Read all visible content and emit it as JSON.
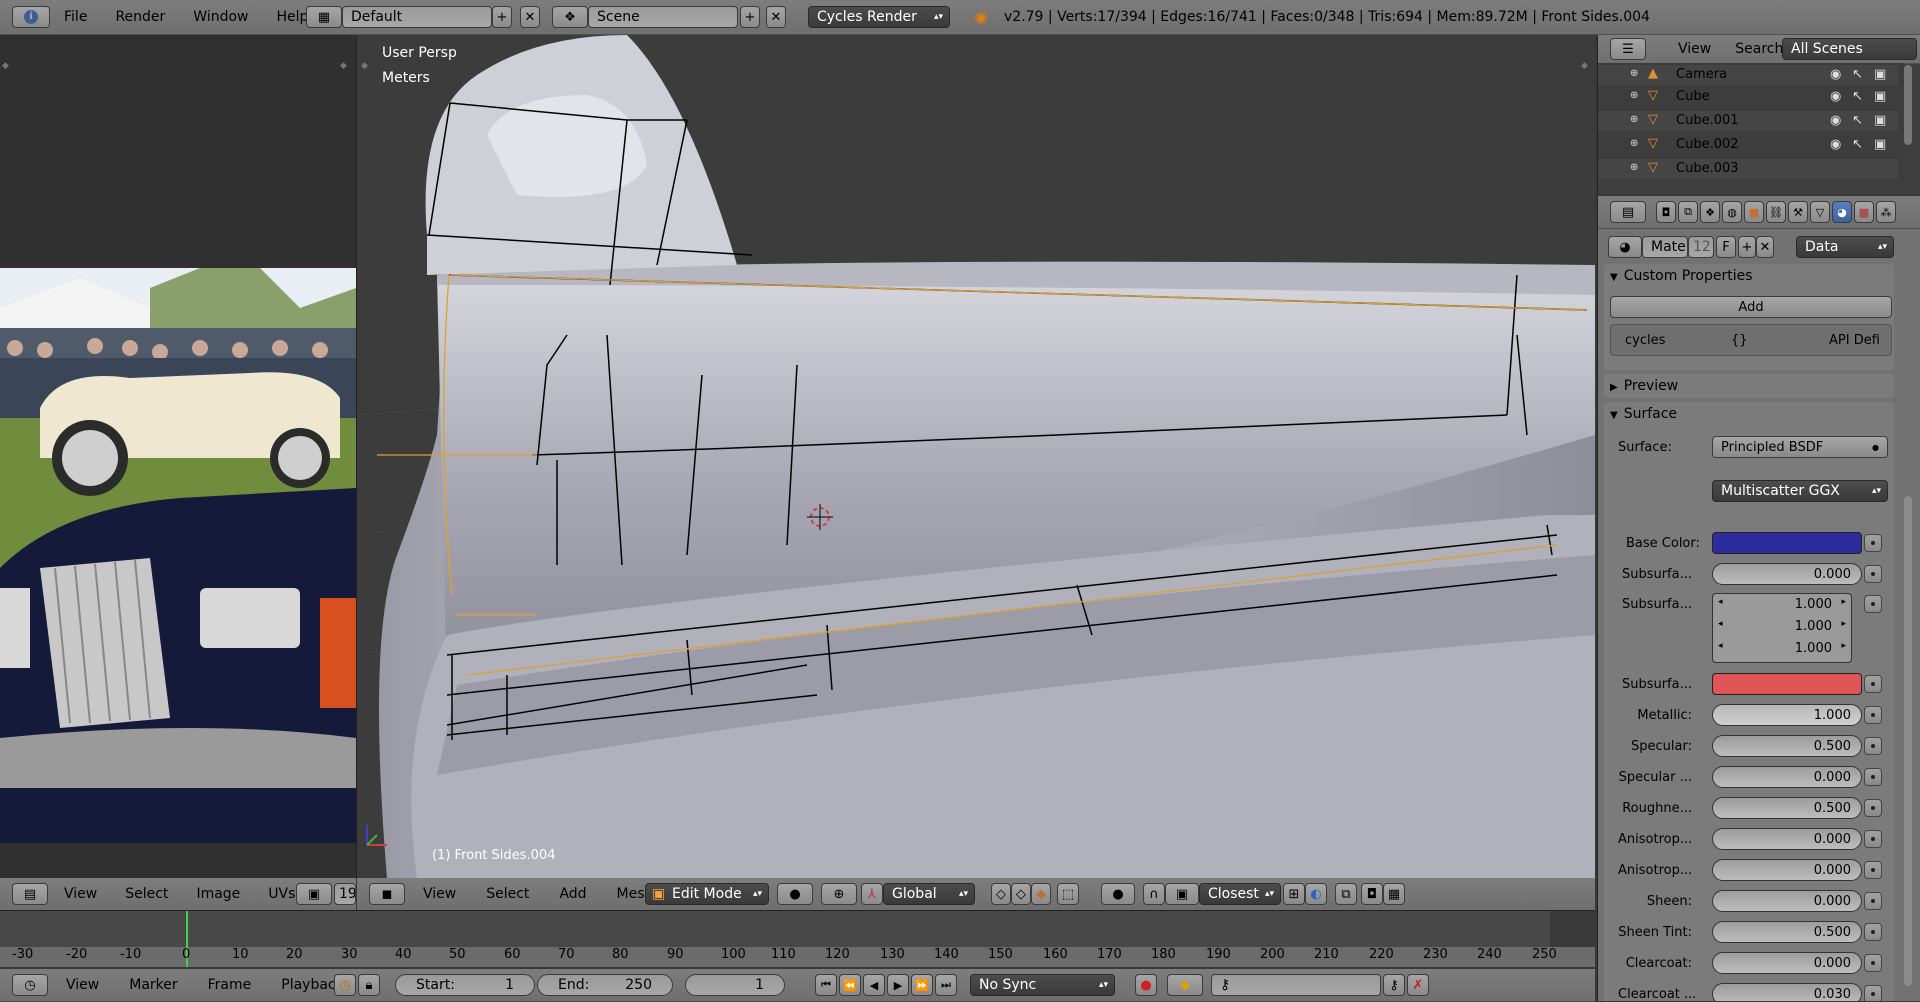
{
  "top_bar": {
    "menus": [
      "File",
      "Render",
      "Window",
      "Help"
    ],
    "layout": "Default",
    "scene": "Scene",
    "engine": "Cycles Render",
    "stats": "v2.79 | Verts:17/394 | Edges:16/741 | Faces:0/348 | Tris:694 | Mem:89.72M | Front Sides.004"
  },
  "viewport": {
    "view_name": "User Persp",
    "units": "Meters",
    "object_label": "(1) Front Sides.004",
    "header": {
      "menus": [
        "View",
        "Select",
        "Add",
        "Mesh"
      ],
      "mode": "Edit Mode",
      "orientation": "Global",
      "snap": "Closest"
    }
  },
  "image_editor": {
    "menus": [
      "View",
      "Select",
      "Image",
      "UVs"
    ],
    "truncated": "19"
  },
  "timeline": {
    "ticks": [
      "-30",
      "-20",
      "-10",
      "0",
      "10",
      "20",
      "30",
      "40",
      "50",
      "60",
      "70",
      "80",
      "90",
      "100",
      "110",
      "120",
      "130",
      "140",
      "150",
      "160",
      "170",
      "180",
      "190",
      "200",
      "210",
      "220",
      "230",
      "240",
      "250"
    ],
    "menus": [
      "View",
      "Marker",
      "Frame",
      "Playback"
    ],
    "start_label": "Start:",
    "start_value": "1",
    "end_label": "End:",
    "end_value": "250",
    "current_frame": "1",
    "sync": "No Sync"
  },
  "outliner": {
    "menus": [
      "View",
      "Search"
    ],
    "filter": "All Scenes",
    "items": [
      "Camera",
      "Cube",
      "Cube.001",
      "Cube.002",
      "Cube.003"
    ]
  },
  "properties": {
    "material_name": "Mate",
    "material_users": "12",
    "fake_user": "F",
    "link": "Data",
    "custom_properties": {
      "title": "Custom Properties",
      "add_label": "Add",
      "prop_name": "cycles",
      "prop_value": "{}",
      "api_label": "API Defi"
    },
    "preview_title": "Preview",
    "surface_title": "Surface",
    "surface_label": "Surface:",
    "surface_shader": "Principled BSDF",
    "distribution": "Multiscatter GGX",
    "base_color_label": "Base Color:",
    "base_color": "#2c2c9e",
    "subsurface_color": "#e05555",
    "rows": [
      {
        "label": "Subsurfa...",
        "value": "0.000"
      },
      {
        "label": "Subsurfa...",
        "values": [
          "1.000",
          "1.000",
          "1.000"
        ]
      },
      {
        "label": "Subsurfa...",
        "color": true
      },
      {
        "label": "Metallic:",
        "value": "1.000"
      },
      {
        "label": "Specular:",
        "value": "0.500"
      },
      {
        "label": "Specular ...",
        "value": "0.000"
      },
      {
        "label": "Roughne...",
        "value": "0.500"
      },
      {
        "label": "Anisotrop...",
        "value": "0.000"
      },
      {
        "label": "Anisotrop...",
        "value": "0.000"
      },
      {
        "label": "Sheen:",
        "value": "0.000"
      },
      {
        "label": "Sheen Tint:",
        "value": "0.500"
      },
      {
        "label": "Clearcoat:",
        "value": "0.000"
      },
      {
        "label": "Clearcoat ...",
        "value": "0.030"
      }
    ]
  }
}
